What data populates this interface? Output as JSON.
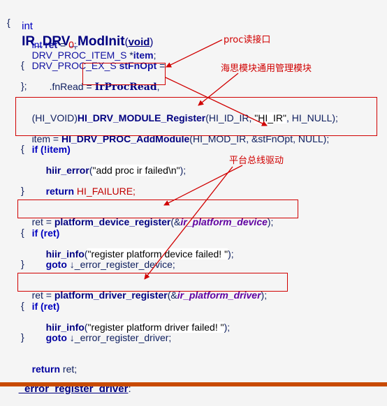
{
  "code": {
    "sig_int": "int",
    "sig_name": "IR_DRV_ModInit",
    "sig_open": "(",
    "sig_void": "void",
    "sig_close": ")",
    "brace_open": "{",
    "l_ret_type": "int",
    "l_ret_var": "ret",
    "l_ret_eq": " = ",
    "l_ret_zero": "0",
    "l_ret_semi": ";",
    "l_item_type": "DRV_PROC_ITEM_S ",
    "l_item_star": "*",
    "l_item_var": "item",
    "l_item_semi": ";",
    "l_opt_type": "DRV_PROC_EX_S ",
    "l_opt_var": "stFnOpt",
    "l_opt_eq": " =",
    "l_inner_open": "{",
    "l_fnread_field": ".fnRead",
    "l_fnread_eq": " = ",
    "l_fnread_val": "IrProcRead",
    "l_fnread_comma": ",",
    "l_inner_close": "};",
    "reg_cast": "(HI_VOID)",
    "reg_fn": "HI_DRV_MODULE_Register",
    "reg_args_a": "(HI_ID_IR, ",
    "reg_str": "\"HI_IR\"",
    "reg_args_b": ", HI_NULL);",
    "add_lhs": "item = ",
    "add_fn": "HI_DRV_PROC_AddModule",
    "add_args": "(HI_MOD_IR, &stFnOpt, NULL);",
    "if1": "if (!item)",
    "if1_open": "{",
    "err_fn": "hiir_error",
    "err_open": "(",
    "err_str": "\"add proc ir failed\\n\"",
    "err_close": ");",
    "ret_fail_kw": "return",
    "ret_fail_val": " HI_FAILURE;",
    "if1_close": "}",
    "dev_lhs": "ret = ",
    "dev_fn": "platform_device_register",
    "dev_open": "(&",
    "dev_arg": "ir_platform_device",
    "dev_close": ");",
    "if2": "if (ret)",
    "if2_open": "{",
    "info1_fn": "hiir_info",
    "info1_open": "(",
    "info1_str": "\"register platform device failed! \"",
    "info1_close": ");",
    "goto1_kw": "goto",
    "goto1_lbl": " ↓_error_register_device;",
    "if2_close": "}",
    "drv_lhs": "ret = ",
    "drv_fn": "platform_driver_register",
    "drv_open": "(&",
    "drv_arg": "ir_platform_driver",
    "drv_close": ");",
    "if3": "if (ret)",
    "if3_open": "{",
    "info2_fn": "hiir_info",
    "info2_open": "(",
    "info2_str": "\"register platform driver failed! \"",
    "info2_close": ");",
    "goto2_kw": "goto",
    "goto2_lbl": " ↓_error_register_driver;",
    "if3_close": "}",
    "ret_kw": "return",
    "ret_val": " ret;",
    "label_err": "_error_register_driver",
    "label_colon": ":"
  },
  "annotations": {
    "proc": "proc读接口",
    "module": "海思模块通用管理模块",
    "platform": "平台总线驱动"
  },
  "colors": {
    "accent_red": "#d00000",
    "keyword_blue": "#0000c0",
    "function_navy": "#000080",
    "arg_purple": "#6000a0",
    "bottom_bar": "#c84a00"
  }
}
